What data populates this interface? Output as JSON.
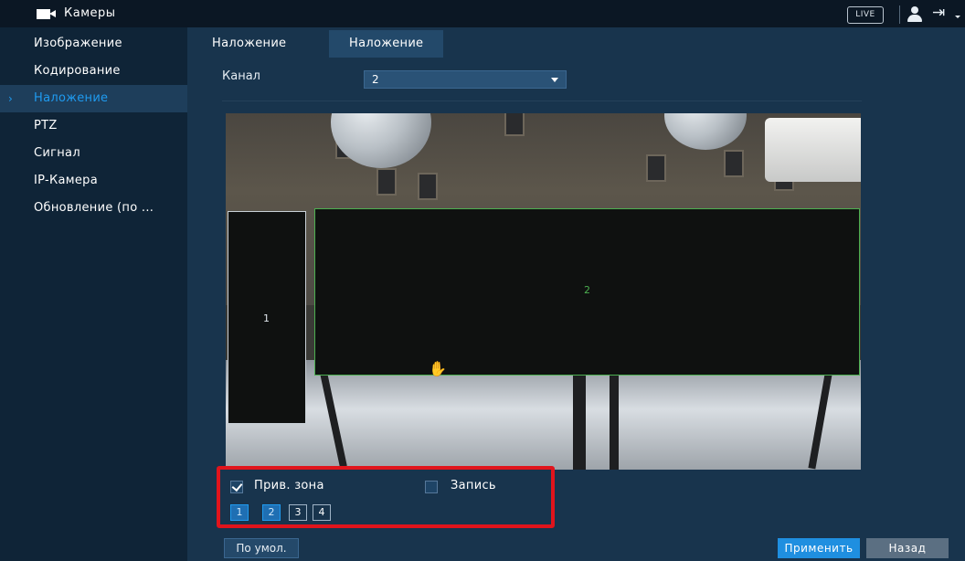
{
  "header": {
    "title": "Камеры",
    "live_label": "LIVE",
    "camera_icon": "camera-icon",
    "user_icon": "user-icon",
    "logout_icon": "logout-icon"
  },
  "sidebar": {
    "items": [
      {
        "label": "Изображение",
        "active": false
      },
      {
        "label": "Кодирование",
        "active": false
      },
      {
        "label": "Наложение",
        "active": true
      },
      {
        "label": "PTZ",
        "active": false
      },
      {
        "label": "Сигнал",
        "active": false
      },
      {
        "label": "IP-Камера",
        "active": false
      },
      {
        "label": "Обновление (по ...",
        "active": false
      }
    ],
    "active_marker": "›"
  },
  "tabs": [
    {
      "label": "Наложение",
      "selected": false
    },
    {
      "label": "Наложение",
      "selected": true
    }
  ],
  "channel": {
    "label": "Канал",
    "value": "2"
  },
  "video": {
    "zones": [
      {
        "label": "1"
      },
      {
        "label": "2"
      }
    ],
    "cursor": "hand-cursor-icon"
  },
  "options": {
    "privacy_zone_label": "Прив. зона",
    "privacy_zone_checked": true,
    "record_label": "Запись",
    "record_checked": false,
    "zone_buttons": [
      {
        "label": "1",
        "selected": true
      },
      {
        "label": "2",
        "selected": true
      },
      {
        "label": "3",
        "selected": false
      },
      {
        "label": "4",
        "selected": false
      }
    ]
  },
  "footer": {
    "default_label": "По умол.",
    "apply_label": "Применить",
    "back_label": "Назад"
  },
  "colors": {
    "accent": "#1f9bf0",
    "highlight": "#e0141c",
    "zone_active_border": "#4caf50"
  }
}
